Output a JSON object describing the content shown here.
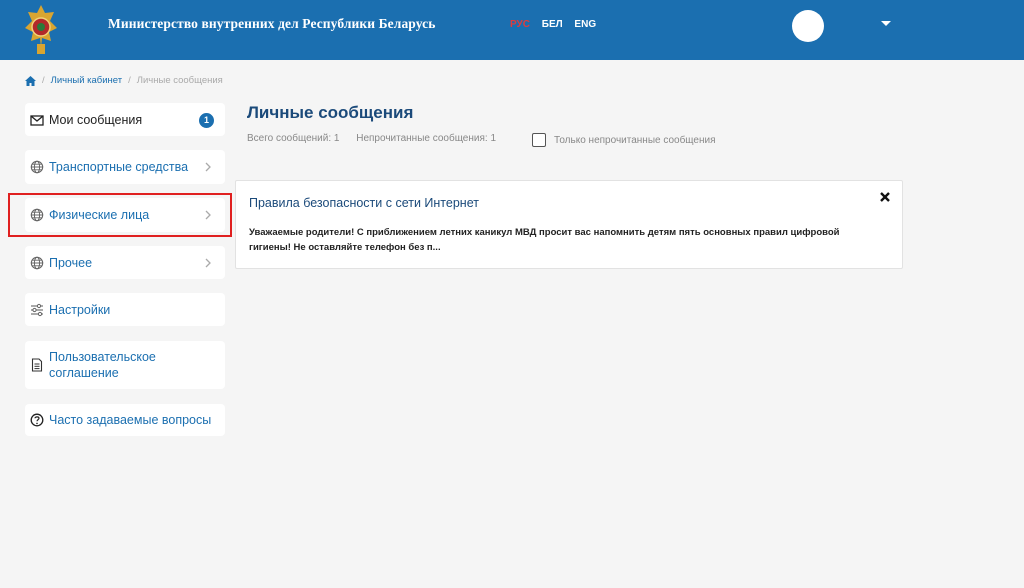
{
  "header": {
    "title": "Министерство внутренних дел Республики Беларусь",
    "languages": [
      "РУС",
      "БЕЛ",
      "ENG"
    ],
    "active_language": "РУС",
    "brand_color": "#1b6fb0"
  },
  "breadcrumb": {
    "home_icon": "home-icon",
    "items": [
      "Личный кабинет",
      "Личные сообщения"
    ]
  },
  "sidebar": {
    "items": [
      {
        "label": "Мои сообщения",
        "icon": "envelope-icon",
        "badge": "1"
      },
      {
        "label": "Транспортные средства",
        "icon": "globe-icon"
      },
      {
        "label": "Физические лица",
        "icon": "globe-icon"
      },
      {
        "label": "Прочее",
        "icon": "globe-icon"
      },
      {
        "label": "Настройки",
        "icon": "sliders-icon"
      },
      {
        "label": "Пользовательское соглашение",
        "icon": "document-icon"
      },
      {
        "label": "Часто задаваемые вопросы",
        "icon": "question-icon"
      }
    ]
  },
  "main": {
    "title": "Личные сообщения",
    "total_label": "Всего сообщений: 1",
    "unread_label": "Непрочитанные сообщения: 1",
    "filter_label": "Только непрочитанные сообщения",
    "filter_checked": false
  },
  "messages": [
    {
      "title": "Правила безопасности с сети Интернет",
      "preview": "Уважаемые родители! С приближением летних каникул МВД просит вас напомнить детям пять основных правил цифровой гигиены! Не оставляйте телефон без п..."
    }
  ]
}
